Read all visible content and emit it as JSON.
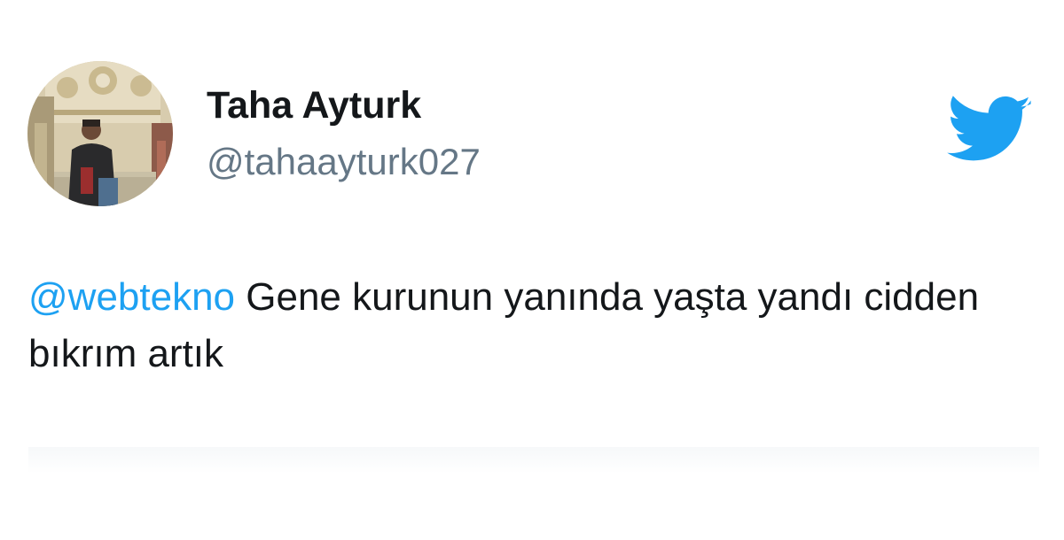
{
  "author": {
    "display_name": "Taha Ayturk",
    "handle": "@tahaayturk027",
    "avatar_icon": "profile-photo"
  },
  "brand": {
    "icon": "twitter-bird-icon",
    "color": "#1da1f2"
  },
  "tweet": {
    "mention": "@webtekno",
    "body": " Gene kurunun yanında yaşta yandı cidden bıkrım artık"
  },
  "colors": {
    "text": "#14171a",
    "secondary": "#657786",
    "link": "#1da1f2"
  }
}
